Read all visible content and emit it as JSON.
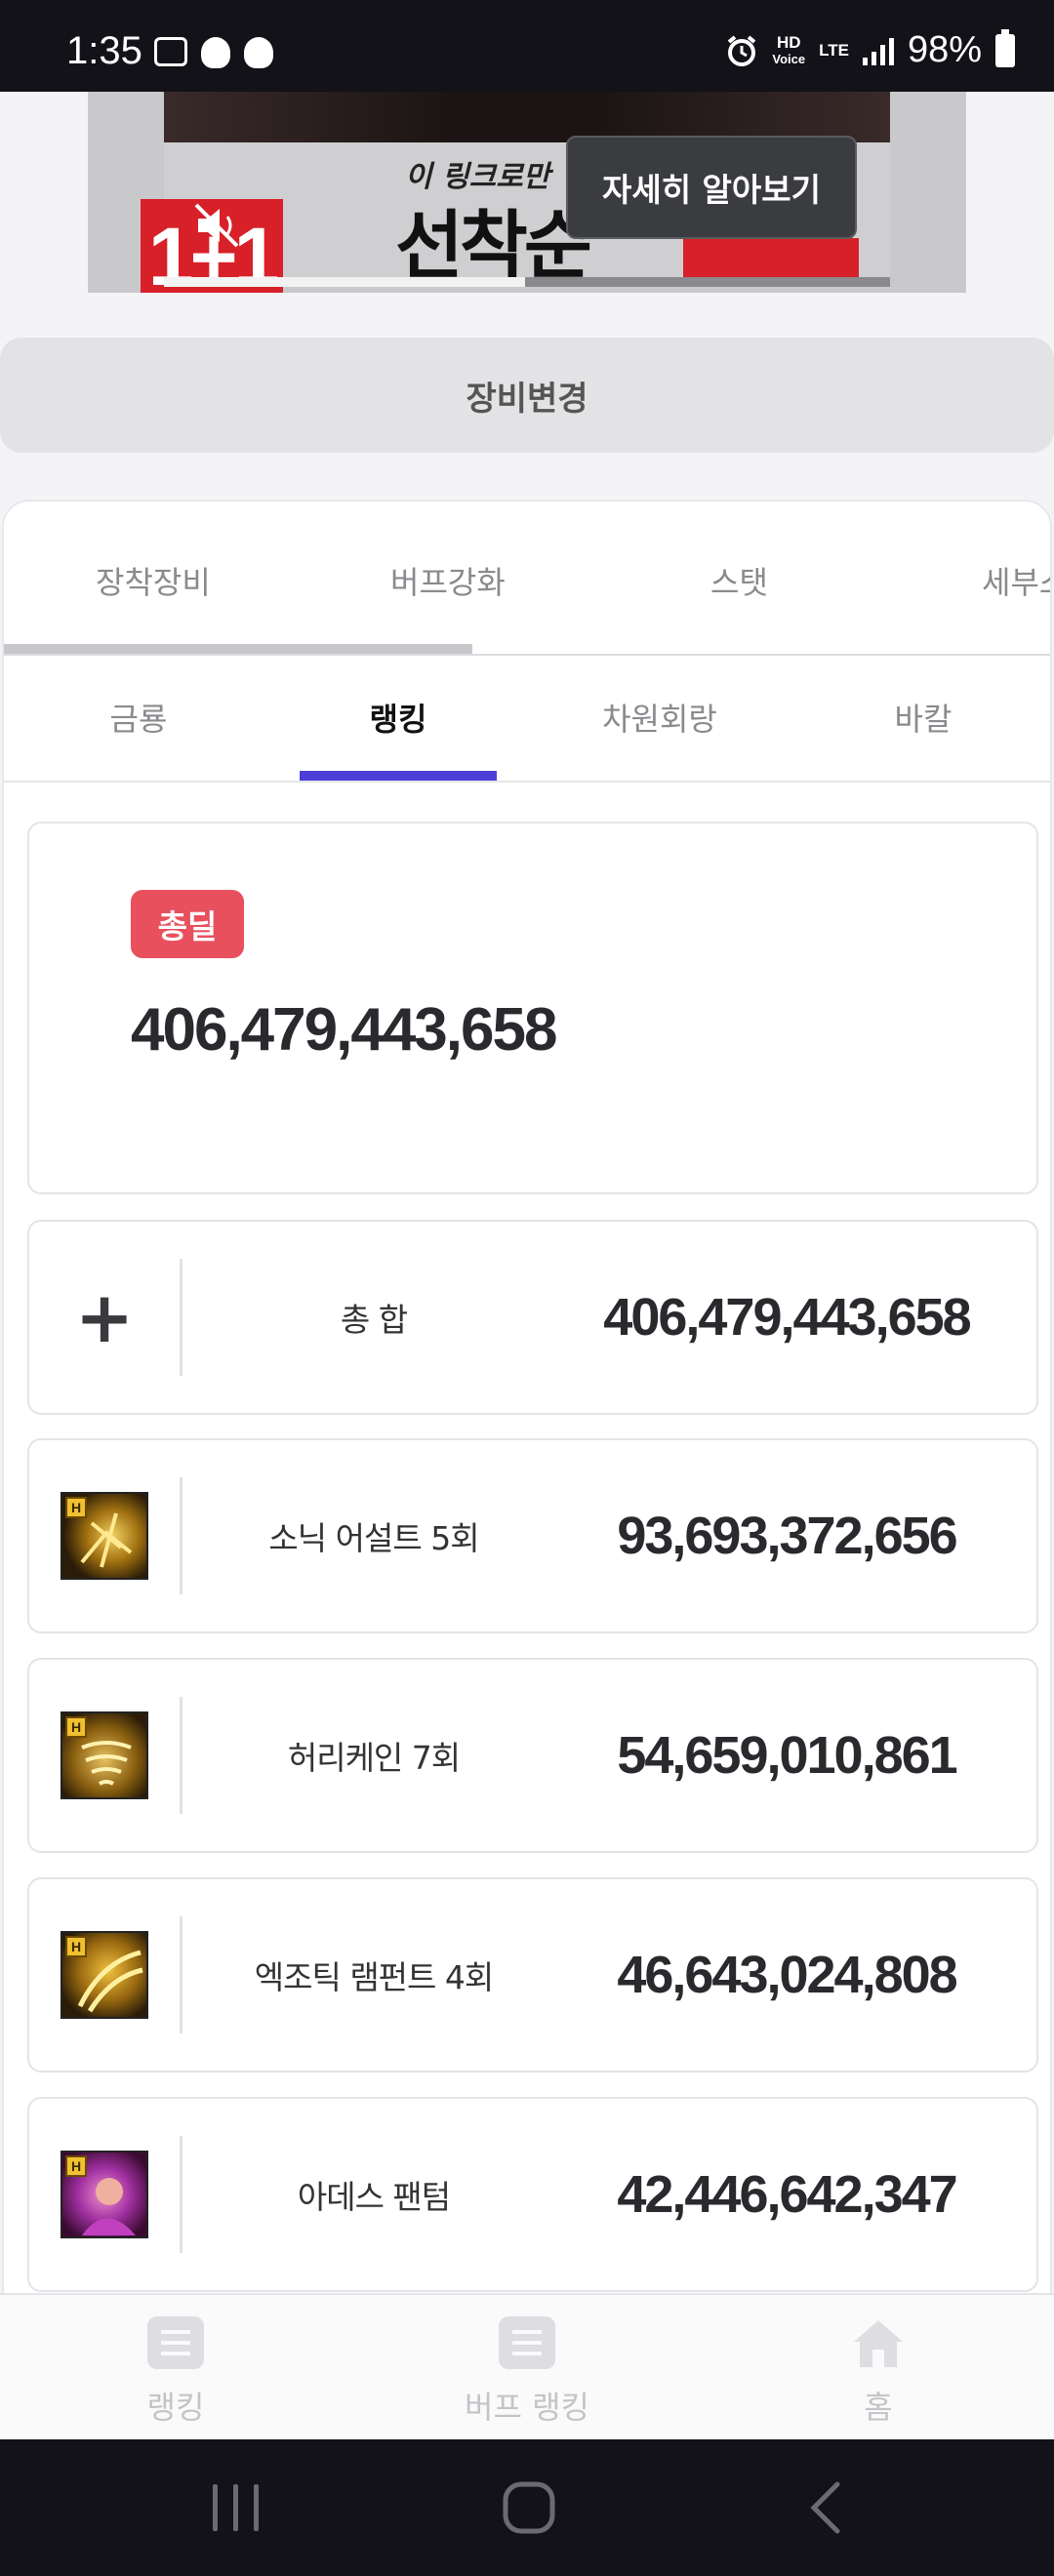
{
  "status_bar": {
    "time": "1:35",
    "net_hd": "HD",
    "net_voice": "Voice",
    "net_lte": "LTE",
    "battery": "98%"
  },
  "ad": {
    "small_text": "이 링크로만",
    "big_text": "선착순",
    "badge_text": "1+1",
    "cta": "자세히 알아보기",
    "progress": 0.5
  },
  "change_button": "장비변경",
  "tabs_primary": [
    "장착장비",
    "버프강화",
    "스탯",
    "세부스"
  ],
  "tabs_secondary": [
    {
      "label": "금룡",
      "active": false
    },
    {
      "label": "랭킹",
      "active": true
    },
    {
      "label": "차원회랑",
      "active": false
    },
    {
      "label": "바칼",
      "active": false
    }
  ],
  "total": {
    "badge": "총딜",
    "value": "406,479,443,658"
  },
  "rows": [
    {
      "name": "총 합",
      "value": "406,479,443,658",
      "icon": "plus-icon"
    },
    {
      "name": "소닉 어설트 5회",
      "value": "93,693,372,656",
      "icon": "sonic-assault-skill-icon"
    },
    {
      "name": "허리케인 7회",
      "value": "54,659,010,861",
      "icon": "hurricane-skill-icon"
    },
    {
      "name": "엑조틱 램펀트 4회",
      "value": "46,643,024,808",
      "icon": "exotic-rampant-skill-icon"
    },
    {
      "name": "아데스 팬텀",
      "value": "42,446,642,347",
      "icon": "hades-phantom-skill-icon"
    }
  ],
  "skill_badge": "H",
  "bottom_nav": [
    "랭킹",
    "버프 랭킹",
    "홈"
  ],
  "colors": {
    "accent": "#4c3fd8",
    "badge": "#e8505e",
    "ad_red": "#d82028"
  }
}
